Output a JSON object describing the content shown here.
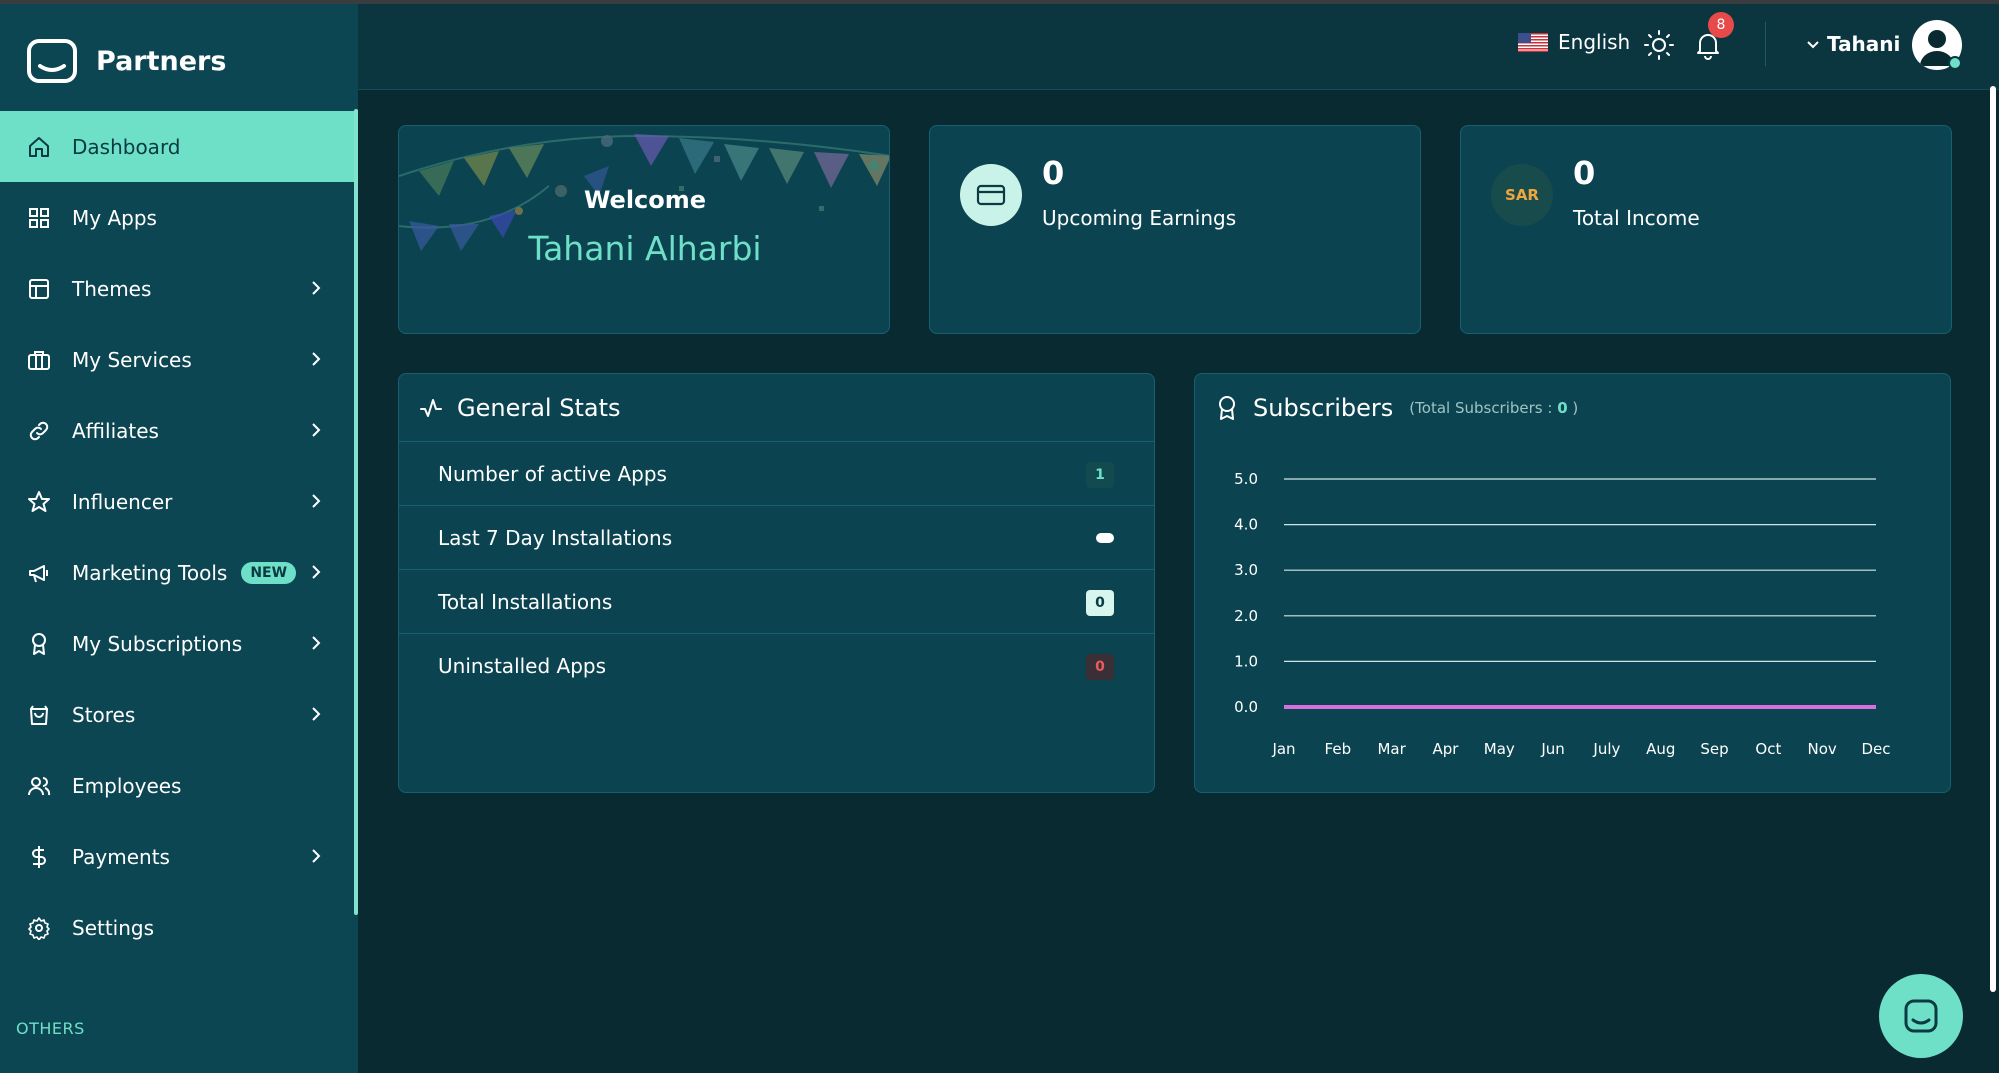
{
  "brand": {
    "name": "Partners"
  },
  "sidebar": {
    "items": [
      {
        "label": "Dashboard",
        "icon": "home-icon",
        "active": true,
        "chevron": false
      },
      {
        "label": "My Apps",
        "icon": "grid-icon",
        "chevron": false
      },
      {
        "label": "Themes",
        "icon": "layout-icon",
        "chevron": true
      },
      {
        "label": "My Services",
        "icon": "briefcase-icon",
        "chevron": true
      },
      {
        "label": "Affiliates",
        "icon": "link-icon",
        "chevron": true
      },
      {
        "label": "Influencer",
        "icon": "star-icon",
        "chevron": true
      },
      {
        "label": "Marketing Tools",
        "icon": "megaphone-icon",
        "chevron": true,
        "badge": "NEW"
      },
      {
        "label": "My Subscriptions",
        "icon": "award-icon",
        "chevron": true
      },
      {
        "label": "Stores",
        "icon": "shopping-bag-icon",
        "chevron": true
      },
      {
        "label": "Employees",
        "icon": "users-icon",
        "chevron": false
      },
      {
        "label": "Payments",
        "icon": "dollar-icon",
        "chevron": true
      },
      {
        "label": "Settings",
        "icon": "gear-icon",
        "chevron": false
      }
    ],
    "section_label": "OTHERS"
  },
  "header": {
    "language": "English",
    "notifications_count": "8",
    "user_name": "Tahani"
  },
  "welcome": {
    "title": "Welcome",
    "name": "Tahani Alharbi"
  },
  "earnings": {
    "value": "0",
    "label": "Upcoming Earnings"
  },
  "income": {
    "currency": "SAR",
    "value": "0",
    "label": "Total Income"
  },
  "general_stats": {
    "title": "General Stats",
    "rows": [
      {
        "label": "Number of active Apps",
        "value": "1"
      },
      {
        "label": "Last 7 Day Installations",
        "value": ""
      },
      {
        "label": "Total Installations",
        "value": "0"
      },
      {
        "label": "Uninstalled Apps",
        "value": "0"
      }
    ]
  },
  "subscribers": {
    "title": "Subscribers",
    "total_label": "(Total Subscribers : ",
    "total_value": "0",
    "total_close": " )"
  },
  "colors": {
    "accent": "#6fe0c8",
    "background": "#0a2a32",
    "sidebar": "#0c4652",
    "card": "#0b4450",
    "series_line": "#d86fe0",
    "badge_red": "#e84a4a"
  },
  "chart_data": {
    "type": "line",
    "categories": [
      "Jan",
      "Feb",
      "Mar",
      "Apr",
      "May",
      "Jun",
      "July",
      "Aug",
      "Sep",
      "Oct",
      "Nov",
      "Dec"
    ],
    "series": [
      {
        "values": [
          0,
          0,
          0,
          0,
          0,
          0,
          0,
          0,
          0,
          0,
          0,
          0
        ]
      }
    ],
    "yticks": [
      "5.0",
      "4.0",
      "3.0",
      "2.0",
      "1.0",
      "0.0"
    ],
    "ylim": [
      0,
      5
    ],
    "grid": true
  }
}
